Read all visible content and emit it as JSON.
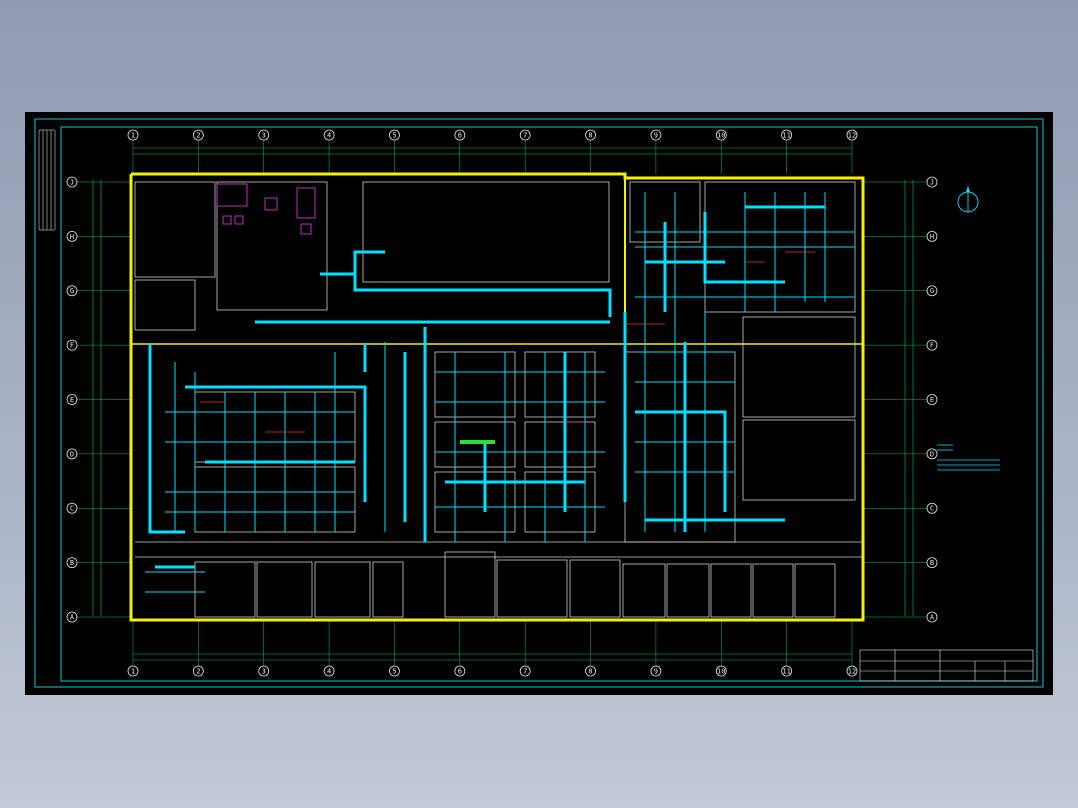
{
  "drawing": {
    "column_axes": [
      "1",
      "2",
      "3",
      "4",
      "5",
      "6",
      "7",
      "8",
      "9",
      "10",
      "11",
      "12"
    ],
    "row_axes": [
      "J",
      "H",
      "G",
      "F",
      "E",
      "D",
      "C",
      "B",
      "A"
    ],
    "colors": {
      "background": "#000000",
      "frame": "#00d0d8",
      "walls": "#f5f000",
      "ducts": "#00e0ff",
      "dimension": "#00c060",
      "equipment": "#d030d0",
      "accent_red": "#ff3030",
      "text": "#e8e8e8"
    },
    "icons": {
      "north_arrow": "north-arrow-icon"
    }
  }
}
